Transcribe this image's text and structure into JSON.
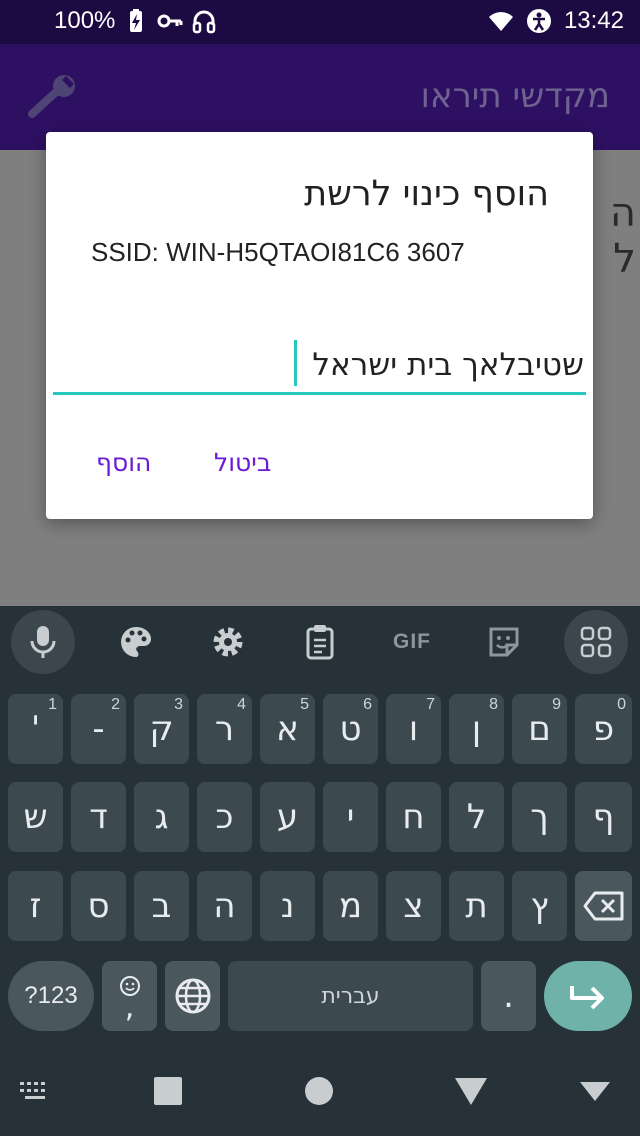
{
  "status_bar": {
    "battery": "100%",
    "time": "13:42",
    "icons": [
      "battery-charging-icon",
      "vpn-key-icon",
      "headset-icon",
      "wifi-icon",
      "accessibility-icon"
    ]
  },
  "app_bar": {
    "title": "מקדשי תיראו",
    "settings_icon": "wrench-icon"
  },
  "background_content": {
    "peek_line_1": "ה",
    "peek_line_2": "ל"
  },
  "dialog": {
    "title": "הוסף כינוי לרשת",
    "ssid_text": "SSID: WIN-H5QTAOI81C6 3607",
    "input_value": "שטיבלאך בית ישראל",
    "cancel_label": "ביטול",
    "add_label": "הוסף",
    "accent_color": "#26c9bb",
    "button_color": "#6a1bd6"
  },
  "keyboard": {
    "toolbar": {
      "gif_label": "GIF",
      "icons": [
        "mic-icon",
        "palette-icon",
        "gear-icon",
        "clipboard-icon",
        "gif-icon",
        "sticker-icon",
        "apps-grid-icon"
      ]
    },
    "row1": [
      {
        "label": "פ",
        "hint": "0"
      },
      {
        "label": "ם",
        "hint": "9"
      },
      {
        "label": "ן",
        "hint": "8"
      },
      {
        "label": "ו",
        "hint": "7"
      },
      {
        "label": "ט",
        "hint": "6"
      },
      {
        "label": "א",
        "hint": "5"
      },
      {
        "label": "ר",
        "hint": "4"
      },
      {
        "label": "ק",
        "hint": "3"
      },
      {
        "label": "-",
        "hint": "2"
      },
      {
        "label": "'",
        "hint": "1"
      }
    ],
    "row2": [
      "ף",
      "ך",
      "ל",
      "ח",
      "י",
      "ע",
      "כ",
      "ג",
      "ד",
      "ש"
    ],
    "row3": [
      "ץ",
      "ת",
      "צ",
      "מ",
      "נ",
      "ה",
      "ב",
      "ס",
      "ז"
    ],
    "row4": {
      "numbers_label": "?123",
      "emoji_comma": ",",
      "space_label": "עברית",
      "period": "."
    }
  },
  "nav_bar": {
    "icons": [
      "keyboard-switch-icon",
      "recents-square-icon",
      "home-circle-icon",
      "back-triangle-icon",
      "hide-keyboard-icon"
    ]
  }
}
